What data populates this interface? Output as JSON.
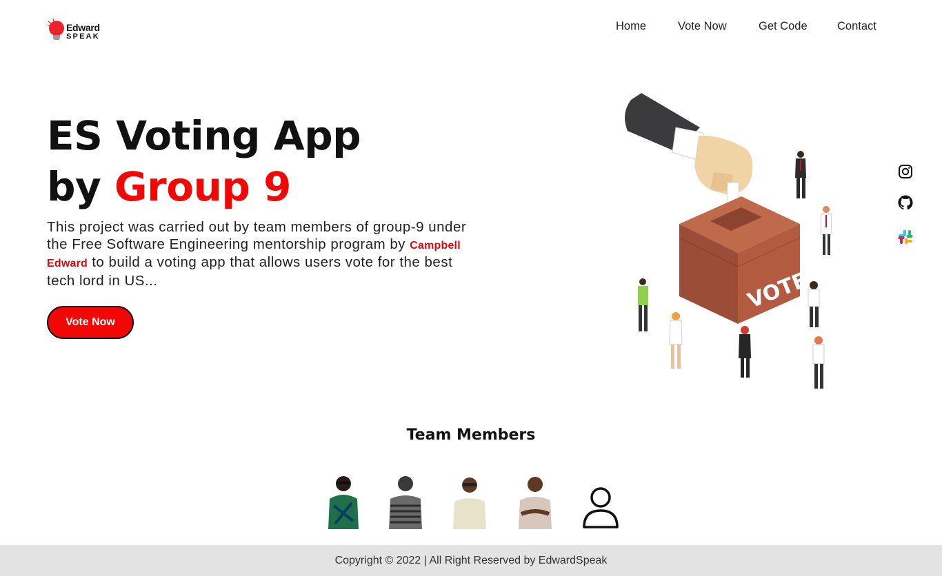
{
  "brand": {
    "name_top": "Edward",
    "name_bottom": "SPEAK",
    "accent": "#e8232a"
  },
  "nav": {
    "items": [
      {
        "label": "Home"
      },
      {
        "label": "Vote Now"
      },
      {
        "label": "Get Code"
      },
      {
        "label": "Contact"
      }
    ]
  },
  "hero": {
    "title_line1": "ES Voting App",
    "title_by": "by ",
    "title_group": "Group 9",
    "text_before": "This project was carried out by team members of group-9 under the Free Software Engineering mentorship program by ",
    "text_name": "Campbell Edward",
    "text_after": " to build a voting app that allows users vote for the best tech lord in US...",
    "button_label": "Vote Now",
    "ballot_box_label": "VOTE"
  },
  "socials": [
    {
      "icon": "instagram-icon"
    },
    {
      "icon": "github-icon"
    },
    {
      "icon": "slack-icon"
    }
  ],
  "team": {
    "title": "Team Members",
    "members": [
      {
        "icon": "member-photo"
      },
      {
        "icon": "member-photo"
      },
      {
        "icon": "member-photo"
      },
      {
        "icon": "member-photo"
      },
      {
        "icon": "user-placeholder-icon"
      }
    ]
  },
  "footer": {
    "text": "Copyright © 2022 | All Right Reserved by EdwardSpeak"
  },
  "colors": {
    "accent": "#f20707",
    "footer_bg": "#e3e3e3",
    "text": "#111111"
  }
}
